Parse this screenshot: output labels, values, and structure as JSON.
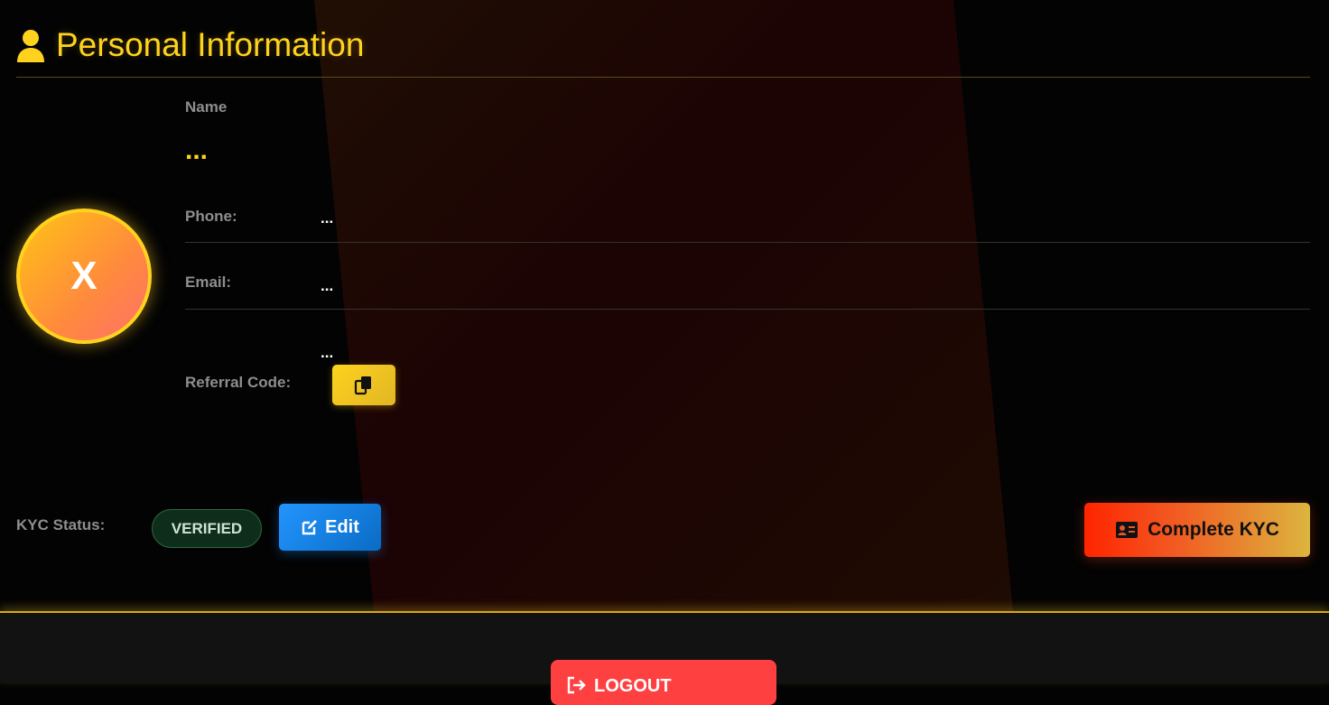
{
  "header": {
    "title": "Personal Information",
    "icon": "user-icon"
  },
  "avatar": {
    "initial": "X"
  },
  "profile": {
    "name_label": "Name",
    "name_value": "...",
    "phone_label": "Phone:",
    "phone_value": "...",
    "email_label": "Email:",
    "email_value": "...",
    "referral_value": "...",
    "referral_label": "Referral Code:",
    "copy_icon": "copy-icon"
  },
  "kyc": {
    "status_label": "KYC Status:",
    "status_badge": "VERIFIED",
    "edit_label": "Edit",
    "complete_label": "Complete KYC"
  },
  "footer": {
    "logout_label": "LOGOUT"
  },
  "colors": {
    "accent": "#ffd21e",
    "edit": "#2395ff",
    "logout": "#ff4040",
    "kyc_start": "#ff2400",
    "kyc_end": "#dcb53e"
  }
}
